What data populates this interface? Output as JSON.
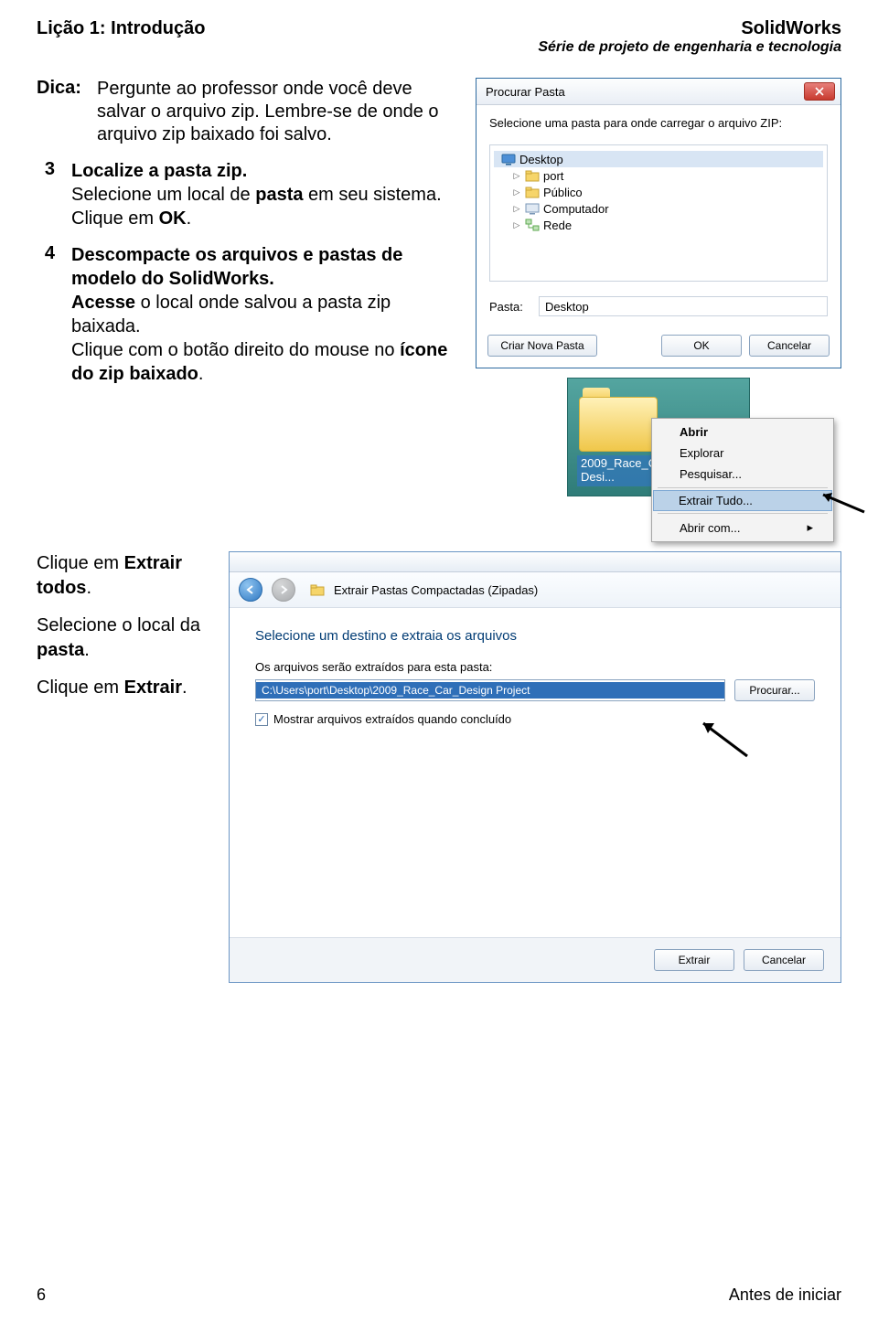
{
  "header": {
    "left": "Lição 1: Introdução",
    "brand": "SolidWorks",
    "sub": "Série de projeto de engenharia e tecnologia"
  },
  "dica_label": "Dica:",
  "dica_text": "Pergunte ao professor onde você deve salvar o arquivo zip. Lembre-se de onde o arquivo zip baixado foi salvo.",
  "step3": {
    "n": "3",
    "title": "Localize a pasta zip.",
    "line1": "Selecione um local de ",
    "bold1": "pasta",
    "line1b": " em seu sistema.",
    "line2a": "Clique em ",
    "bold2": "OK",
    "line2b": "."
  },
  "step4": {
    "n": "4",
    "title": "Descompacte os arquivos e pastas de modelo do SolidWorks.",
    "line1a": "Acesse",
    "line1b": " o local onde salvou a pasta zip baixada.",
    "line2a": "Clique com o botão direito do mouse no ",
    "bold2": "ícone do zip baixado",
    "line2b": "."
  },
  "dlg1": {
    "title": "Procurar Pasta",
    "prompt": "Selecione uma pasta para onde carregar o arquivo ZIP:",
    "tree": {
      "desktop": "Desktop",
      "port": "port",
      "publico": "Público",
      "computador": "Computador",
      "rede": "Rede"
    },
    "pasta_label": "Pasta:",
    "pasta_value": "Desktop",
    "btn_new": "Criar Nova Pasta",
    "btn_ok": "OK",
    "btn_cancel": "Cancelar"
  },
  "ctx": {
    "folder_label1": "2009_Race_Car",
    "folder_label2": "Desi...",
    "mi_abrir": "Abrir",
    "mi_explorar": "Explorar",
    "mi_pesquisar": "Pesquisar...",
    "mi_extrair": "Extrair Tudo...",
    "mi_abrircom": "Abrir com..."
  },
  "block2": {
    "p1a": "Clique em ",
    "p1b": "Extrair todos",
    "p1c": ".",
    "p2a": "Selecione o local da ",
    "p2b": "pasta",
    "p2c": ".",
    "p3a": "Clique em ",
    "p3b": "Extrair",
    "p3c": "."
  },
  "wiz": {
    "breadcrumb": "Extrair Pastas Compactadas (Zipadas)",
    "title": "Selecione um destino e extraia os arquivos",
    "label": "Os arquivos serão extraídos para esta pasta:",
    "path": "C:\\Users\\port\\Desktop\\2009_Race_Car_Design Project",
    "browse": "Procurar...",
    "chk_label": "Mostrar arquivos extraídos quando concluído",
    "btn_extract": "Extrair",
    "btn_cancel": "Cancelar"
  },
  "footer": {
    "page": "6",
    "label": "Antes de iniciar"
  }
}
